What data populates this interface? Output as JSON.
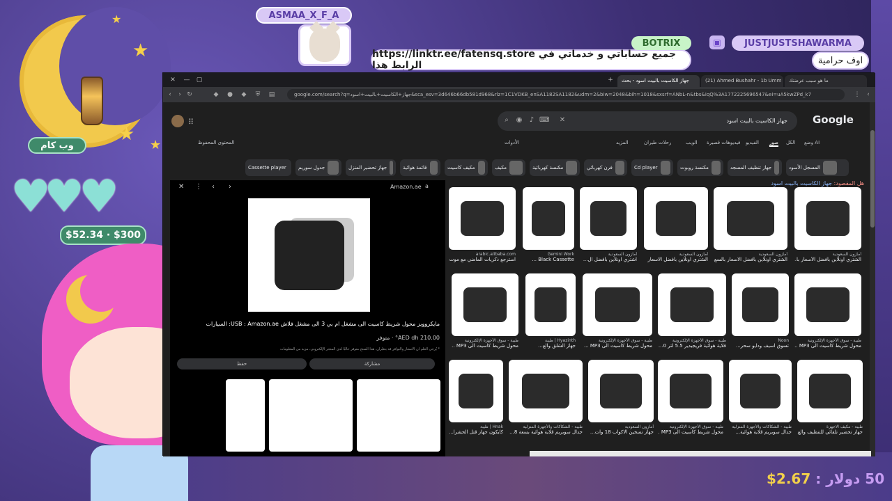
{
  "overlay": {
    "streamer_tag": "ASMAA_X_F_A",
    "message": "https://linktr.ee/fatensq.store جميع حساباتي و خدماتي في الرابط هذا",
    "bot_tag": "BOTRIX",
    "user2_tag": "JUSTJUSTSHAWARMA",
    "user2_message": "اوف حرامية",
    "label_wb": "وب كام",
    "money": "$52.34 · $300",
    "bottom_text": "50 دولار : ",
    "bottom_amount": "2.67$"
  },
  "browser": {
    "tabs": [
      {
        "label": "ما هو سبب عرضتك",
        "active": false
      },
      {
        "label": "(21) Ahmed Bushahr - 1b Umm",
        "active": false
      },
      {
        "label": "جهاز الكاسيت بالبيت اسود - بحث",
        "active": true
      }
    ],
    "url": "google.com/search?q=جهاز+الكاسيت+بالبيت+اسود&sca_esv=3d646b66db581d968&rlz=1C1VDKB_enSA1182SA1182&udm=2&biw=2048&bih=1018&sxsrf=ANbL-n&tbs&iqQ%3A1772225696547&ei=uA5kwZPd_k7"
  },
  "google": {
    "logo": "Google",
    "query": "جهاز الكاسيت بالبيت اسود",
    "nav": [
      {
        "label": "وضع AI",
        "active": false
      },
      {
        "label": "الكل",
        "active": false
      },
      {
        "label": "صور",
        "active": true
      },
      {
        "label": "الفيديو",
        "active": false
      },
      {
        "label": "فيديوهات قصيرة",
        "active": false
      },
      {
        "label": "الويب",
        "active": false
      },
      {
        "label": "رحلات طيران",
        "active": false
      },
      {
        "label": "المزيد",
        "active": false
      },
      {
        "label": "الأدوات",
        "active": false
      }
    ],
    "saved_label": "المحتوى المحفوظ",
    "chips": [
      "المسجل الأسود",
      "جهاز تنظيف المسجد",
      "مكنسة روبوت",
      "Cd player",
      "فرن كهربائي",
      "مكنسة كهربائية",
      "مكيف",
      "مكيف كاسيت",
      "قائمة هوائية",
      "جهاز تحضير المنزل",
      "جدول سوريم",
      "Cassette player"
    ],
    "alt_prefix": "هل المقصود:",
    "alt_query": "جهاز الكاسيت بالبيت اسود",
    "preview": {
      "source": "Amazon.ae",
      "title": "مايكروويز محول شريط كاسيت الى مشغل ام بي 3 الى مشغل فلاش USB : Amazon.ae: السيارات",
      "price": "210.00 AED dh° · متوفر",
      "note": "* يُرجى العلم أن الأسعار والتوافر قد يتغيّران. هذا المنتج متوفر حاليًا لدى المتجر الإلكتروني، مزيد من المعلومات",
      "share": "مشاركة",
      "save": "حفظ"
    },
    "results": [
      {
        "src": "أمازون السعودية",
        "title": "الشتري اونلاين بأفضل الأسعار با..."
      },
      {
        "src": "أمازون السعودية",
        "title": "الشتري اونلاين بأفضل الاسعار بالسع..."
      },
      {
        "src": "أمازون السعودية",
        "title": "الشتري اونلاين بأفضل الاسعار"
      },
      {
        "src": "أمازون السعودية",
        "title": "اشتري اونلاين بأفضل ال..."
      },
      {
        "src": "Gemini Work",
        "title": "Black Cassette ..."
      },
      {
        "src": "arabic.alibaba.com",
        "title": "استرجع ذكريات الماضي مع موت..."
      },
      {
        "src": "طيبة - سوق الأجهزة الإلكترونية",
        "title": "محول شريط كاسيت الى MP3 ..."
      },
      {
        "src": "Noon",
        "title": "تسوق اسيف ودايو سحر..."
      },
      {
        "src": "طيبة - سوق الأجهزة الإلكترونية",
        "title": "قلاية هوائية فريجيدير 5.5 لتر 0..."
      },
      {
        "src": "طيبة - سوق الأجهزة الإلكترونية",
        "title": "محول شريط كاسيت الى MP3 ..."
      },
      {
        "src": "Hyazinth | طيبة",
        "title": "جهاز الشلق والع..."
      },
      {
        "src": "طيبة - سوق الأجهزة الإلكترونية",
        "title": "محول شريط كاسيت الى MP3 ..."
      },
      {
        "src": "طيبة - مكيف الاجهزة",
        "title": "جهاز تحضير تلقائي للتنظيف والع..."
      },
      {
        "src": "طيبة - الشكاكات والأجهزة المنزلية",
        "title": "جدال سوبريم قلاية هوائية..."
      },
      {
        "src": "طيبة - سوق الأجهزة الإلكترونية",
        "title": "محول شريط كاسيت الى MP3 ..."
      },
      {
        "src": "أمازون السعودية",
        "title": "جهاز تسخين الاكواب 18 وات..."
      },
      {
        "src": "طيبة - الشكاكات والأجهزة المنزلية",
        "title": "جدال سوبريم قلاية هوائية بسعة 8..."
      },
      {
        "src": "Hnak | طيبة",
        "title": "كايكون جهاز قتل الحشرا..."
      }
    ]
  }
}
